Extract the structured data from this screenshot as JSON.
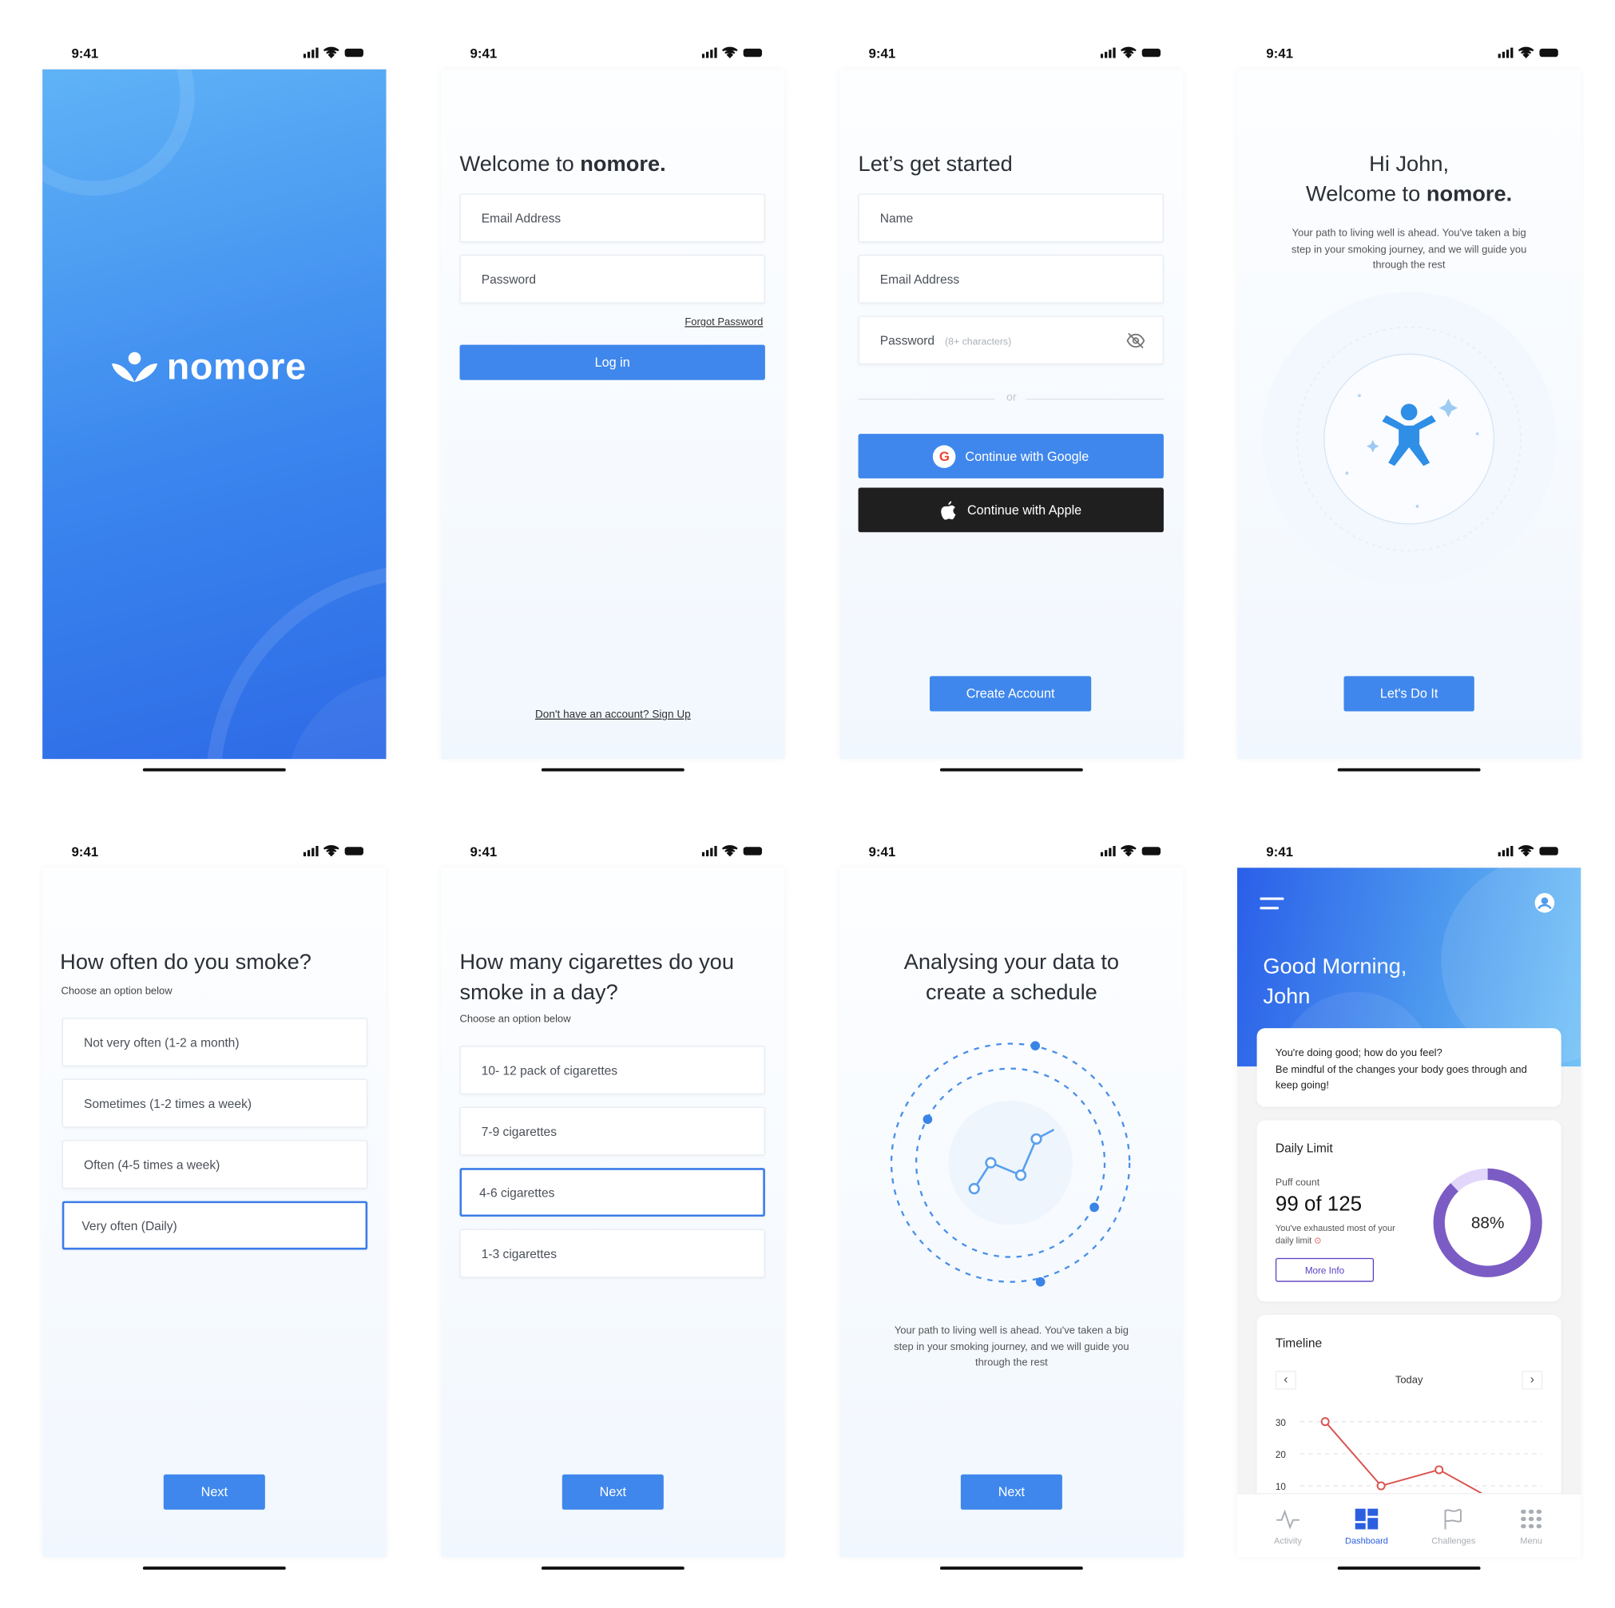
{
  "status": {
    "time": "9:41"
  },
  "splash": {
    "brand": "nomore",
    "colors": {
      "top": "#5fb2f5",
      "bottom": "#2f6fe8"
    }
  },
  "login": {
    "title_prefix": "Welcome to ",
    "title_brand": "nomore.",
    "email_placeholder": "Email Address",
    "password_placeholder": "Password",
    "forgot_password": "Forgot Password",
    "login_button": "Log in",
    "signup_link": "Don't have an account? Sign Up"
  },
  "signup": {
    "title": "Let’s get started",
    "name_placeholder": "Name",
    "email_placeholder": "Email Address",
    "password_placeholder": "Password",
    "password_hint": "(8+ characters)",
    "divider": "or",
    "google_button": "Continue with Google",
    "apple_button": "Continue with Apple",
    "create_button": "Create Account"
  },
  "welcome": {
    "greeting": "Hi John,",
    "title_prefix": "Welcome to ",
    "title_brand": "nomore.",
    "body": "Your path to living well is ahead. You've taken a big step in your smoking journey, and we will guide you through the rest",
    "button": "Let's Do It"
  },
  "frequency": {
    "title": "How often do you smoke?",
    "subtitle": "Choose an option below",
    "options": [
      "Not very often (1-2 a month)",
      "Sometimes (1-2 times a week)",
      "Often (4-5 times a week)",
      "Very often (Daily)"
    ],
    "selected": "Very often (Daily)",
    "next": "Next"
  },
  "quantity": {
    "title_line1": "How many cigarettes do you",
    "title_line2": "smoke in a day?",
    "subtitle": "Choose an option below",
    "options": [
      "10- 12 pack of cigarettes",
      "7-9 cigarettes",
      "4-6 cigarettes",
      "1-3 cigarettes"
    ],
    "selected": "4-6 cigarettes",
    "next": "Next"
  },
  "analysing": {
    "title_line1": "Analysing your data to",
    "title_line2": "create a schedule",
    "body": "Your path to living well is ahead. You've taken a big step in your smoking journey, and we will guide you through the rest",
    "next": "Next"
  },
  "dashboard": {
    "greeting_line1": "Good Morning,",
    "greeting_line2": "John",
    "message_line1": "You're doing good; how do you feel?",
    "message_line2": "Be mindful of the changes your body goes through and keep going!",
    "daily_limit": {
      "title": "Daily Limit",
      "label": "Puff count",
      "count": "99 of 125",
      "note": "You've exhausted most of your daily limit",
      "more_info": "More Info",
      "percent_label": "88%",
      "percent": 88,
      "ring_color": "#7b5cc4",
      "track_color": "#e2d6fb"
    },
    "timeline": {
      "title": "Timeline",
      "period": "Today",
      "y_ticks": [
        "30",
        "20",
        "10"
      ],
      "values": [
        30,
        10,
        15,
        5
      ],
      "line_color": "#d9534f"
    },
    "nav": [
      {
        "label": "Activity",
        "icon": "activity-icon"
      },
      {
        "label": "Dashboard",
        "icon": "dashboard-icon",
        "active": true
      },
      {
        "label": "Challenges",
        "icon": "flag-icon"
      },
      {
        "label": "Menu",
        "icon": "grid-icon"
      }
    ],
    "accent": "#2b5fe0"
  }
}
